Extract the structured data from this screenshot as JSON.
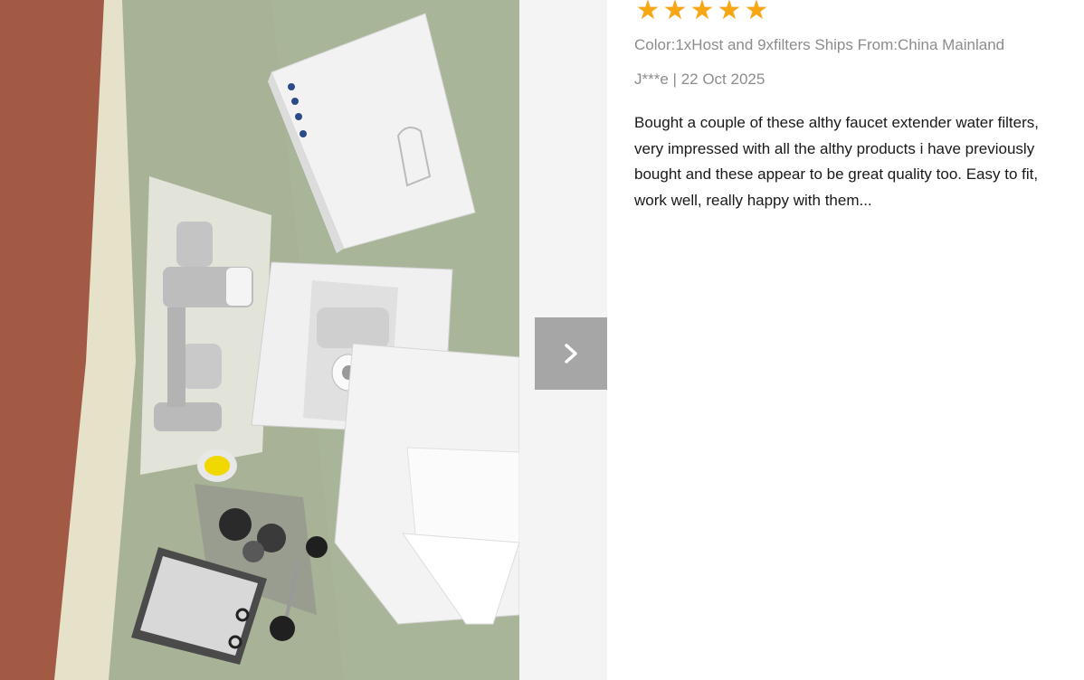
{
  "gallery": {
    "photo_alt": "Customer photo of faucet extender filter kit",
    "next_icon": "chevron-right-icon"
  },
  "review": {
    "rating": 5,
    "star_color": "#f7a614",
    "sku_line": "Color:1xHost and 9xfilters Ships From:China Mainland",
    "author": "J***e",
    "separator": "|",
    "date": "22 Oct 2025",
    "text": "Bought a couple of these althy faucet extender water filters, very impressed with all the althy products i have previously bought and these appear to be great quality too. Easy to fit, work well, really happy with them..."
  }
}
